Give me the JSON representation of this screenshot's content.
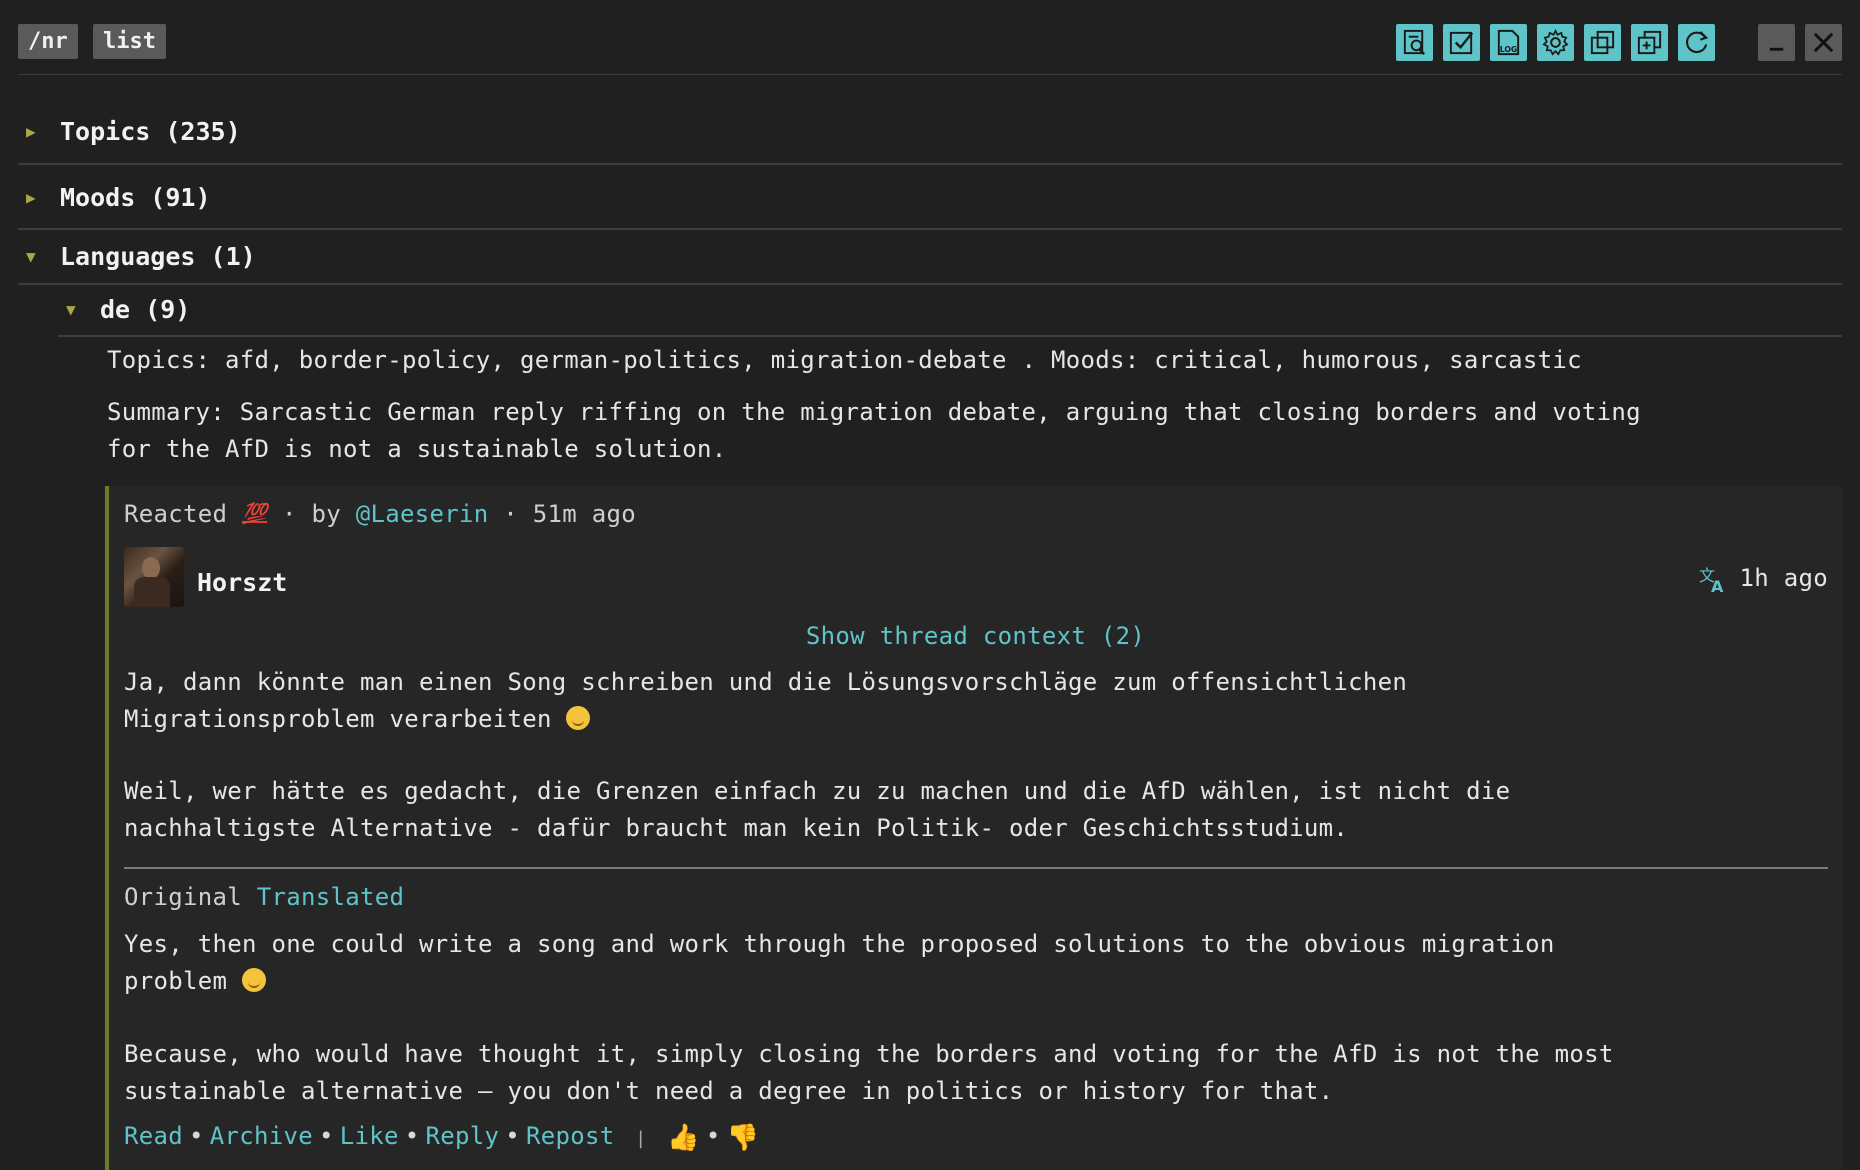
{
  "toolbar": {
    "chips": [
      "/nr",
      "list"
    ],
    "buttons": [
      {
        "name": "search-doc-icon"
      },
      {
        "name": "checkbox-icon"
      },
      {
        "name": "log-icon",
        "label": "LOG"
      },
      {
        "name": "gear-icon"
      },
      {
        "name": "copy-icon"
      },
      {
        "name": "add-window-icon"
      },
      {
        "name": "refresh-icon"
      }
    ],
    "window_controls": [
      "minimize-icon",
      "close-icon"
    ]
  },
  "sections": {
    "topics": {
      "label": "Topics (235)",
      "expanded": false
    },
    "moods": {
      "label": "Moods (91)",
      "expanded": false
    },
    "languages": {
      "label": "Languages (1)",
      "expanded": true
    }
  },
  "language_group": {
    "label": "de (9)",
    "meta_line": "Topics: afd, border-policy, german-politics, migration-debate . Moods: critical, humorous, sarcastic",
    "summary_line1": "Summary: Sarcastic German reply riffing on the migration debate, arguing that closing borders and voting",
    "summary_line2": "for the AfD is not a sustainable solution."
  },
  "post": {
    "reacted_prefix": "Reacted",
    "reaction_emoji": "💯",
    "by_text": "· by",
    "reactor": "@Laeserin",
    "reacted_time": "· 51m ago",
    "author": "Horszt",
    "time": "1h ago",
    "thread_context": "Show thread context (2)",
    "original_p1_l1": "Ja, dann könnte man einen Song schreiben und die Lösungsvorschläge zum offensichtlichen",
    "original_p1_l2": "Migrationsproblem verarbeiten",
    "original_p2_l1": "Weil, wer hätte es gedacht, die Grenzen einfach zu zu machen und die AfD wählen, ist nicht die",
    "original_p2_l2": "nachhaltigste Alternative - dafür braucht man kein Politik- oder Geschichtsstudium.",
    "tab_original": "Original",
    "tab_translated": "Translated",
    "translated_p1_l1": "Yes, then one could write a song and work through the proposed solutions to the obvious migration",
    "translated_p1_l2": "problem",
    "translated_p2_l1": "Because, who would have thought it, simply closing the borders and voting for the AfD is not the most",
    "translated_p2_l2": "sustainable alternative — you don't need a degree in politics or history for that.",
    "actions": [
      "Read",
      "Archive",
      "Like",
      "Reply",
      "Repost"
    ],
    "separator": "|",
    "thumbs_up": "👍",
    "thumbs_down": "👎"
  },
  "colors": {
    "accent": "#5fc4c8",
    "background": "#202020",
    "thread_bar": "#6e7a2a",
    "triangle": "#a8a84a"
  }
}
